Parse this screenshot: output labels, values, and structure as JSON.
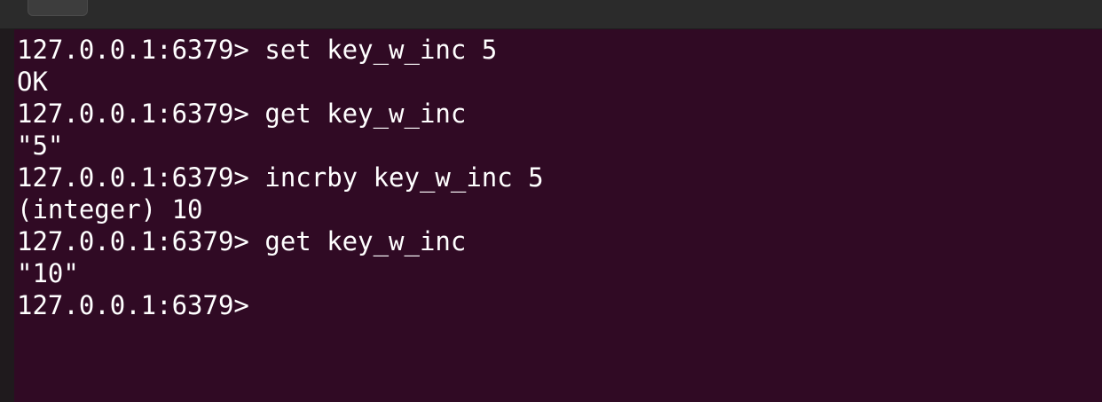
{
  "terminal": {
    "lines": [
      {
        "prompt": "127.0.0.1:6379>",
        "command": " set key_w_inc 5"
      },
      {
        "output": "OK"
      },
      {
        "prompt": "127.0.0.1:6379>",
        "command": " get key_w_inc"
      },
      {
        "output": "\"5\""
      },
      {
        "prompt": "127.0.0.1:6379>",
        "command": " incrby key_w_inc 5"
      },
      {
        "output": "(integer) 10"
      },
      {
        "prompt": "127.0.0.1:6379>",
        "command": " get key_w_inc"
      },
      {
        "output": "\"10\""
      },
      {
        "prompt": "127.0.0.1:6379>",
        "command": ""
      }
    ]
  },
  "colors": {
    "background": "#300a24",
    "text": "#ffffff",
    "titlebar": "#2b2b2b"
  }
}
